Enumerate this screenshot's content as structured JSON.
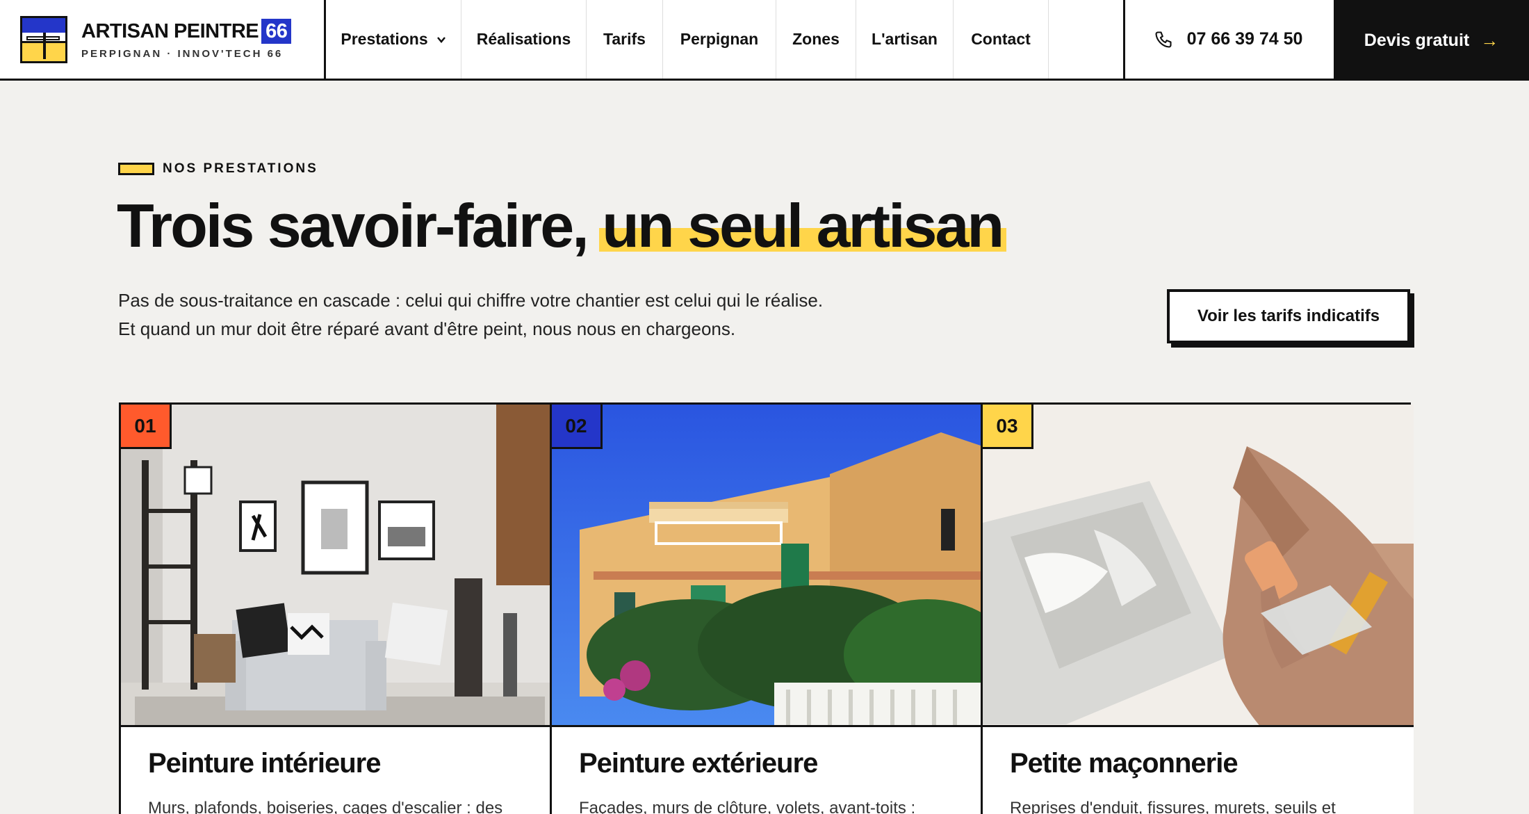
{
  "header": {
    "brand_name": "ARTISAN PEINTRE",
    "brand_number": "66",
    "brand_sub": "PERPIGNAN · INNOV'TECH 66",
    "nav": [
      "Prestations",
      "Réalisations",
      "Tarifs",
      "Perpignan",
      "Zones",
      "L'artisan",
      "Contact"
    ],
    "phone": "07 66 39 74 50",
    "cta_label": "Devis gratuit",
    "cta_arrow": "→"
  },
  "section": {
    "eyebrow": "NOS PRESTATIONS",
    "title_main": "Trois savoir-faire,",
    "title_highlight": "un seul artisan",
    "intro_line1": "Pas de sous-traitance en cascade : celui qui chiffre votre chantier est celui qui le réalise.",
    "intro_line2": "Et quand un mur doit être réparé avant d'être peint, nous nous en chargeons.",
    "button_label": "Voir les tarifs indicatifs"
  },
  "cards": [
    {
      "number": "01",
      "title": "Peinture intérieure",
      "desc": "Murs, plafonds, boiseries, cages d'escalier : des",
      "badge_color": "#ff5a2c"
    },
    {
      "number": "02",
      "title": "Peinture extérieure",
      "desc": "Façades, murs de clôture, volets, avant-toits :",
      "badge_color": "#2436c9"
    },
    {
      "number": "03",
      "title": "Petite maçonnerie",
      "desc": "Reprises d'enduit, fissures, murets, seuils et",
      "badge_color": "#ffd54a"
    }
  ],
  "colors": {
    "accent_yellow": "#ffd54a",
    "brand_blue": "#2436c9",
    "accent_orange": "#ff5a2c",
    "ink": "#111111"
  }
}
